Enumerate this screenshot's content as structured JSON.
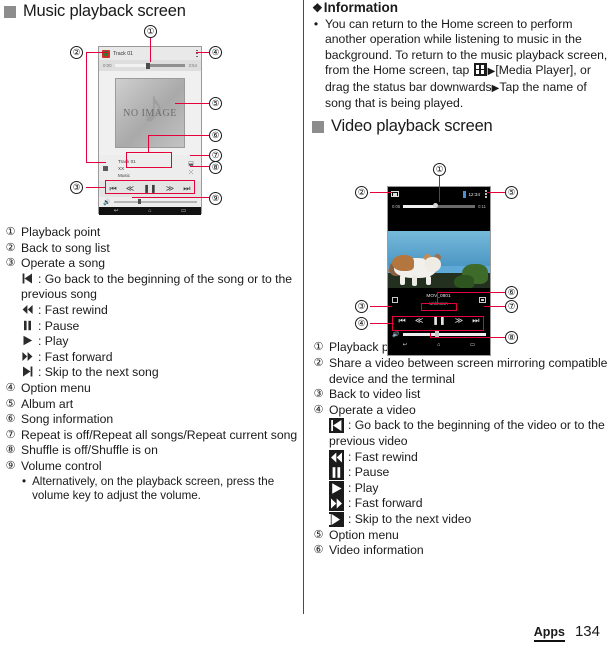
{
  "footer": {
    "section": "Apps",
    "page": "134"
  },
  "left": {
    "heading": "Music playback screen",
    "items": [
      {
        "num": "①",
        "text": "Playback point"
      },
      {
        "num": "②",
        "text": "Back to song list"
      },
      {
        "num": "③",
        "text": "Operate a song"
      },
      {
        "num": "④",
        "text": "Option menu"
      },
      {
        "num": "⑤",
        "text": "Album art"
      },
      {
        "num": "⑥",
        "text": "Song information"
      },
      {
        "num": "⑦",
        "text": "Repeat is off/Repeat all songs/Repeat current song"
      },
      {
        "num": "⑧",
        "text": "Shuffle is off/Shuffle is on"
      },
      {
        "num": "⑨",
        "text": "Volume control"
      }
    ],
    "song_ops": [
      {
        "icon": "skip-previous-icon",
        "text": ": Go back to the beginning of the song or to the"
      },
      {
        "icon": "fast-rewind-icon",
        "text": ": Fast rewind"
      },
      {
        "icon": "pause-icon",
        "text": ": Pause"
      },
      {
        "icon": "play-icon",
        "text": ": Play"
      },
      {
        "icon": "fast-forward-icon",
        "text": ": Fast forward"
      },
      {
        "icon": "skip-next-icon",
        "text": ": Skip to the next song"
      }
    ],
    "song_ops_cont": "previous song",
    "volume_note": "Alternatively, on the playback screen, press the volume key to adjust the volume.",
    "volume_note_bullet": "•"
  },
  "right": {
    "info_heading": "Information",
    "info_diamond": "❖",
    "info_bullet": "•",
    "info_text_1": "You can return to the Home screen to perform another operation while listening to music in the background. To return to the music playback screen, from the Home screen, tap",
    "info_text_2": "[Media Player], or drag the status bar downwards",
    "info_text_3": "Tap the name of song that is being played.",
    "triangle": "▶",
    "heading": "Video playback screen",
    "items": [
      {
        "num": "①",
        "text": "Playback point"
      },
      {
        "num": "②",
        "text": "Share a video between screen mirroring compatible device and the terminal"
      },
      {
        "num": "③",
        "text": "Back to video list"
      },
      {
        "num": "④",
        "text": "Operate a video"
      },
      {
        "num": "⑤",
        "text": "Option menu"
      },
      {
        "num": "⑥",
        "text": "Video information"
      }
    ],
    "video_ops": [
      {
        "icon": "skip-previous-icon",
        "text": ": Go back to the beginning of the video or to the"
      },
      {
        "icon": "fast-rewind-icon",
        "text": ": Fast rewind"
      },
      {
        "icon": "pause-icon",
        "text": ": Pause"
      },
      {
        "icon": "play-icon",
        "text": ": Play"
      },
      {
        "icon": "fast-forward-icon",
        "text": ": Fast forward"
      },
      {
        "icon": "skip-next-icon",
        "text": ": Skip to the next video"
      }
    ],
    "video_ops_cont": "previous video"
  },
  "music_phone": {
    "status_title": "Track 01",
    "time_elapsed": "0:00",
    "time_total": "3:54",
    "album_art_label": "NO IMAGE",
    "song_title": "Track 01",
    "song_artist": "XX",
    "song_album": "Music",
    "repeat_glyph": "⬓",
    "shuffle_glyph": "⤫",
    "controls": [
      "⏮",
      "≪",
      "❚❚",
      "≫",
      "⏭"
    ],
    "volume_icon": "🔊",
    "nav": [
      "↩",
      "⌂",
      "▭"
    ],
    "callouts": [
      "①",
      "②",
      "③",
      "④",
      "⑤",
      "⑥",
      "⑦",
      "⑧",
      "⑨"
    ]
  },
  "video_phone": {
    "status_clock": "12:34",
    "time_elapsed": "0:05",
    "time_total": "0:11",
    "video_title": "MOV_0801",
    "video_artist": "Unknown",
    "controls": [
      "⏮",
      "≪",
      "❚❚",
      "≫",
      "⏭"
    ],
    "volume_icon": "🔊",
    "nav": [
      "↩",
      "⌂",
      "▭"
    ],
    "callouts": [
      "①",
      "②",
      "③",
      "④",
      "⑤",
      "⑥",
      "⑦",
      "⑧"
    ]
  }
}
